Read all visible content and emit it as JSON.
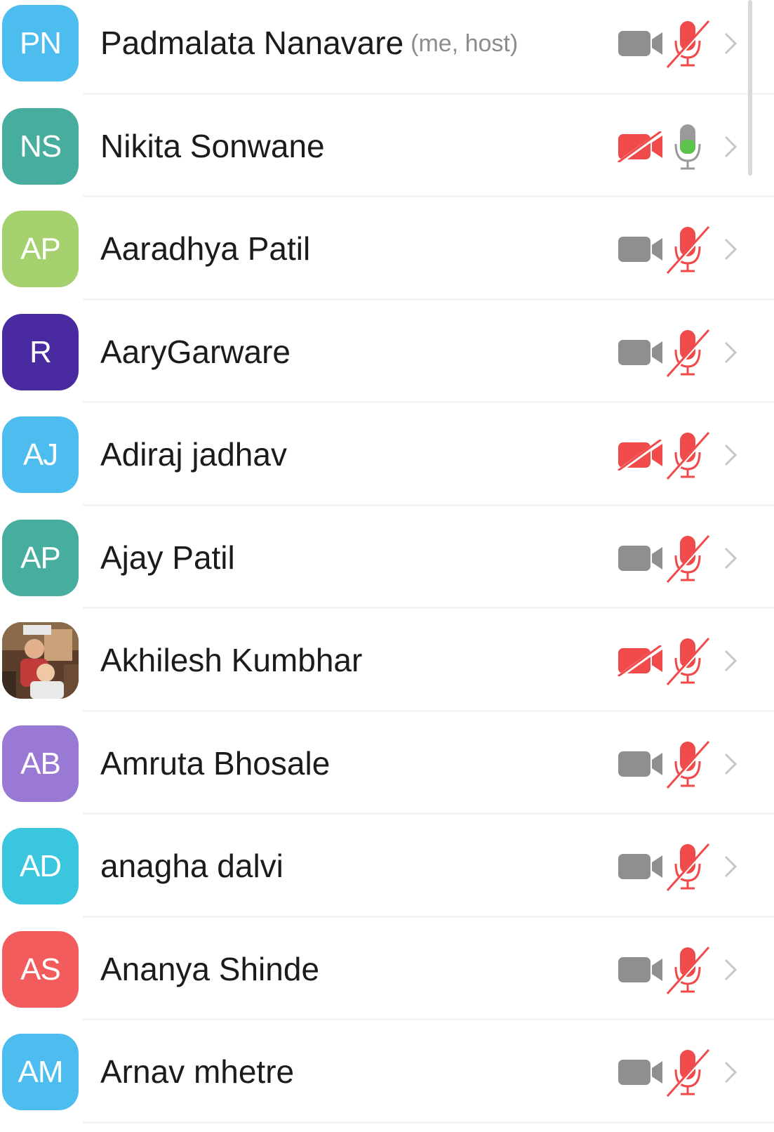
{
  "participants": [
    {
      "initials": "PN",
      "name": "Padmalata Nanavare",
      "tag": "(me, host)",
      "avatar_color": "#4dbdf0",
      "video": "off",
      "audio": "muted"
    },
    {
      "initials": "NS",
      "name": "Nikita Sonwane",
      "tag": "",
      "avatar_color": "#46ad9f",
      "video": "blocked",
      "audio": "active"
    },
    {
      "initials": "AP",
      "name": "Aaradhya Patil",
      "tag": "",
      "avatar_color": "#a4d16d",
      "video": "off",
      "audio": "muted"
    },
    {
      "initials": "R",
      "name": "AaryGarware",
      "tag": "",
      "avatar_color": "#4a2aa0",
      "video": "off",
      "audio": "muted"
    },
    {
      "initials": "AJ",
      "name": "Adiraj jadhav",
      "tag": "",
      "avatar_color": "#4dbdf0",
      "video": "blocked",
      "audio": "muted"
    },
    {
      "initials": "AP",
      "name": "Ajay Patil",
      "tag": "",
      "avatar_color": "#46ad9f",
      "video": "off",
      "audio": "muted"
    },
    {
      "initials": "",
      "name": "Akhilesh Kumbhar",
      "tag": "",
      "avatar_color": "#7a5a3c",
      "photo": true,
      "video": "blocked",
      "audio": "muted"
    },
    {
      "initials": "AB",
      "name": "Amruta Bhosale",
      "tag": "",
      "avatar_color": "#9a79d4",
      "video": "off",
      "audio": "muted"
    },
    {
      "initials": "AD",
      "name": "anagha dalvi",
      "tag": "",
      "avatar_color": "#3bc6e0",
      "video": "off",
      "audio": "muted"
    },
    {
      "initials": "AS",
      "name": "Ananya Shinde",
      "tag": "",
      "avatar_color": "#f25c5c",
      "video": "off",
      "audio": "muted"
    },
    {
      "initials": "AM",
      "name": "Arnav mhetre",
      "tag": "",
      "avatar_color": "#4dbdf0",
      "video": "off",
      "audio": "muted"
    }
  ],
  "colors": {
    "muted_red": "#f04a4a",
    "camera_gray": "#8f8f8f",
    "mic_gray": "#9a9a9a",
    "mic_green": "#5cc34a",
    "chevron": "#c7c7c7"
  }
}
